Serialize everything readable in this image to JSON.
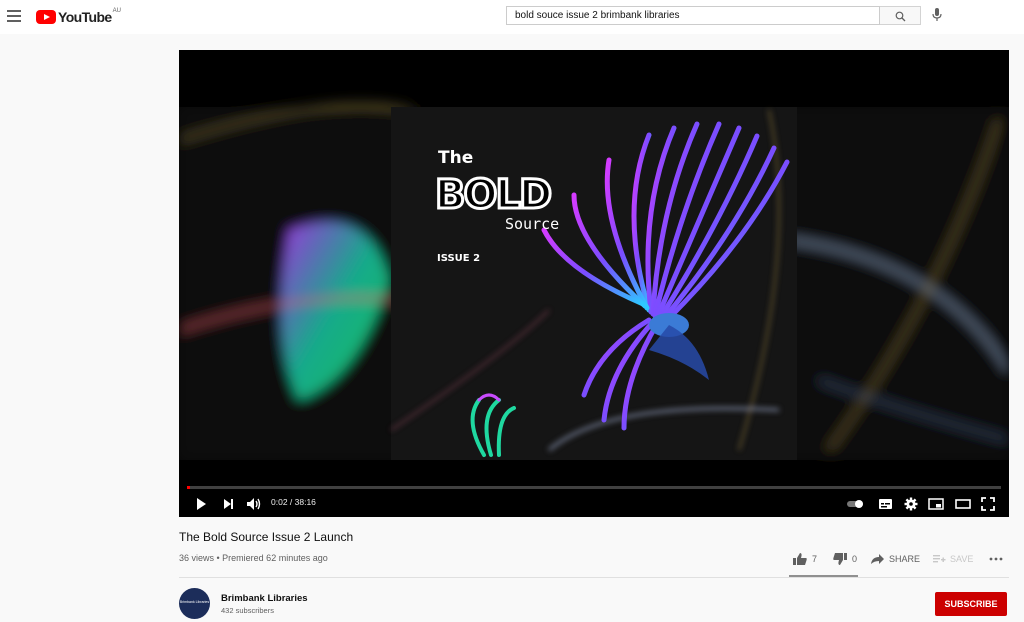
{
  "header": {
    "logo_text": "YouTube",
    "region": "AU",
    "search_value": "bold souce issue 2 brimbank libraries",
    "icons": [
      "menu-icon",
      "search-icon",
      "mic-icon"
    ]
  },
  "player": {
    "time_display": "0:02 / 38:16",
    "progress_fraction": 0.0009,
    "cover": {
      "the": "The",
      "bold": "BOLD",
      "source": "Source",
      "issue": "ISSUE 2"
    },
    "controls": [
      "play-icon",
      "next-icon",
      "volume-icon",
      "autoplay-toggle",
      "subtitles-icon",
      "settings-icon",
      "miniplayer-icon",
      "theater-icon",
      "fullscreen-icon"
    ]
  },
  "video": {
    "title": "The Bold Source Issue 2 Launch",
    "meta": "36 views • Premiered 62 minutes ago",
    "likes": "7",
    "dislikes": "0",
    "share_label": "SHARE",
    "save_label": "SAVE"
  },
  "channel": {
    "name": "Brimbank Libraries",
    "subscribers": "432 subscribers",
    "avatar_text": "Brimbank Libraries",
    "subscribe_label": "SUBSCRIBE"
  },
  "colors": {
    "brand_red": "#ff0000",
    "subscribe_red": "#cc0000",
    "background": "#f9f9f9"
  }
}
